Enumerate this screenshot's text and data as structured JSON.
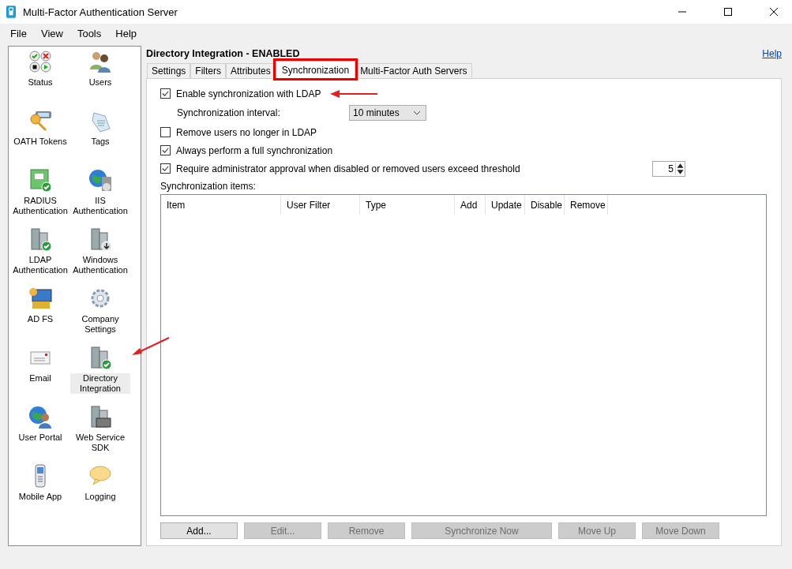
{
  "window": {
    "title": "Multi-Factor Authentication Server"
  },
  "menu": [
    "File",
    "View",
    "Tools",
    "Help"
  ],
  "sidebar": {
    "items": [
      {
        "label": "Status",
        "selected": false
      },
      {
        "label": "Users",
        "selected": false
      },
      {
        "label": "OATH Tokens",
        "selected": false
      },
      {
        "label": "Tags",
        "selected": false
      },
      {
        "label": "RADIUS Authentication",
        "selected": false
      },
      {
        "label": "IIS Authentication",
        "selected": false
      },
      {
        "label": "LDAP Authentication",
        "selected": false
      },
      {
        "label": "Windows Authentication",
        "selected": false
      },
      {
        "label": "AD FS",
        "selected": false
      },
      {
        "label": "Company Settings",
        "selected": false
      },
      {
        "label": "Email",
        "selected": false
      },
      {
        "label": "Directory Integration",
        "selected": true
      },
      {
        "label": "User Portal",
        "selected": false
      },
      {
        "label": "Web Service SDK",
        "selected": false
      },
      {
        "label": "Mobile App",
        "selected": false
      },
      {
        "label": "Logging",
        "selected": false
      }
    ]
  },
  "page": {
    "title": "Directory Integration - ENABLED",
    "help_link": "Help"
  },
  "tabs": [
    {
      "label": "Settings",
      "selected": false,
      "highlighted": false
    },
    {
      "label": "Filters",
      "selected": false,
      "highlighted": false
    },
    {
      "label": "Attributes",
      "selected": false,
      "highlighted": false
    },
    {
      "label": "Synchronization",
      "selected": true,
      "highlighted": true
    },
    {
      "label": "Multi-Factor Auth Servers",
      "selected": false,
      "highlighted": false
    }
  ],
  "options": [
    {
      "kind": "checkbox",
      "label": "Enable synchronization with LDAP",
      "checked": true
    },
    {
      "kind": "dropdown",
      "label": "Synchronization interval:",
      "value": "10 minutes"
    },
    {
      "kind": "checkbox",
      "label": "Remove users no longer in LDAP",
      "checked": false
    },
    {
      "kind": "checkbox",
      "label": "Always perform a full synchronization",
      "checked": true
    },
    {
      "kind": "spinner",
      "label": "Require administrator approval when disabled or removed users exceed threshold",
      "checked": true,
      "value": "5"
    }
  ],
  "table": {
    "label": "Synchronization items:",
    "columns": [
      "Item",
      "User Filter",
      "Type",
      "Add",
      "Update",
      "Disable",
      "Remove"
    ]
  },
  "buttons": [
    {
      "label": "Add...",
      "disabled": false
    },
    {
      "label": "Edit...",
      "disabled": true
    },
    {
      "label": "Remove",
      "disabled": true
    },
    {
      "label": "Synchronize Now",
      "disabled": true
    },
    {
      "label": "Move Up",
      "disabled": true
    },
    {
      "label": "Move Down",
      "disabled": true
    }
  ]
}
